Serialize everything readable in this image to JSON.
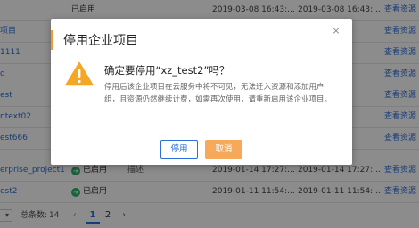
{
  "table": {
    "rows": [
      {
        "name": "",
        "status": "已启用",
        "description": "",
        "created": "2019-03-08 16:43:...",
        "updated": "2019-03-08 16:43:...",
        "action": "查看资源",
        "show_dot": false
      },
      {
        "name": "项目",
        "status": "",
        "description": "",
        "created": "",
        "updated": "",
        "action": "查看资源",
        "show_dot": false
      },
      {
        "name": "1111",
        "status": "",
        "description": "",
        "created": "",
        "updated": "",
        "action": "查看资源",
        "show_dot": false
      },
      {
        "name": "q",
        "status": "",
        "description": "",
        "created": "",
        "updated": "",
        "action": "查看资源",
        "show_dot": false
      },
      {
        "name": "est",
        "status": "",
        "description": "",
        "created": "",
        "updated": "",
        "action": "查看资源",
        "show_dot": false
      },
      {
        "name": "ntext02",
        "status": "",
        "description": "",
        "created": "",
        "updated": "",
        "action": "查看资源",
        "show_dot": false
      },
      {
        "name": "est666",
        "status": "",
        "description": "",
        "created": "",
        "updated": "",
        "action": "查看资源",
        "show_dot": false
      },
      {
        "name": "erprise_project1",
        "status": "已启用",
        "description": "描述",
        "created": "2019-01-14 17:27:...",
        "updated": "2019-01-14 17:27:...",
        "action": "查看资源",
        "show_dot": true
      },
      {
        "name": "est2",
        "status": "已启用",
        "description": "",
        "created": "2019-01-11 11:54:...",
        "updated": "2019-01-11 11:54:...",
        "action": "查看资源",
        "show_dot": true
      }
    ]
  },
  "pagination": {
    "page_size_glyph": "▾",
    "total_label": "总条数:",
    "total_value": "14",
    "prev_glyph": "‹",
    "next_glyph": "›",
    "pages": [
      "1",
      "2"
    ],
    "current_page": 1
  },
  "dialog": {
    "title": "停用企业项目",
    "close_glyph": "×",
    "question": "确定要停用“xz_test2”吗？",
    "description": "停用后该企业项目在云服务中将不可见，无法迁入资源和添加用户组，且资源仍然继续计费，如需再次使用，请重新启用该企业项目。",
    "confirm_label": "停用",
    "cancel_label": "取消"
  },
  "colors": {
    "accent_orange": "#f29a38",
    "link_blue": "#2a6fdb",
    "status_green": "#2fb36b",
    "warning_yellow": "#f5a623"
  },
  "icons": {
    "warning": "warning-icon",
    "close": "close-icon",
    "status": "status-enabled-icon"
  }
}
